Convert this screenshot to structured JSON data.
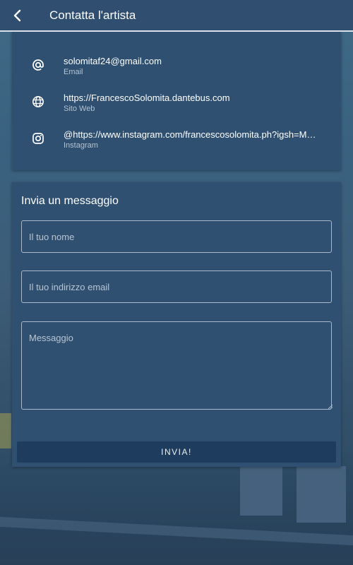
{
  "app_bar": {
    "title": "Contatta l'artista",
    "back_icon": "chevron-left-icon"
  },
  "contacts": [
    {
      "icon": "at-icon",
      "value": "solomitaf24@gmail.com",
      "label": "Email"
    },
    {
      "icon": "globe-icon",
      "value": "https://FrancescoSolomita.dantebus.com",
      "label": "Sito Web"
    },
    {
      "icon": "instagram-icon",
      "value": "@https://www.instagram.com/francescosolomita.ph?igsh=M…",
      "label": "Instagram"
    }
  ],
  "message_form": {
    "heading": "Invia un messaggio",
    "name_placeholder": "Il tuo nome",
    "email_placeholder": "Il tuo indirizzo email",
    "message_placeholder": "Messaggio",
    "submit_label": "INVIA!"
  },
  "colors": {
    "app_bar": "#2f4e70",
    "card": "#2f5071",
    "button": "#1e3d5e",
    "text_primary": "#ffffff",
    "text_secondary": "#b4c2d0"
  }
}
